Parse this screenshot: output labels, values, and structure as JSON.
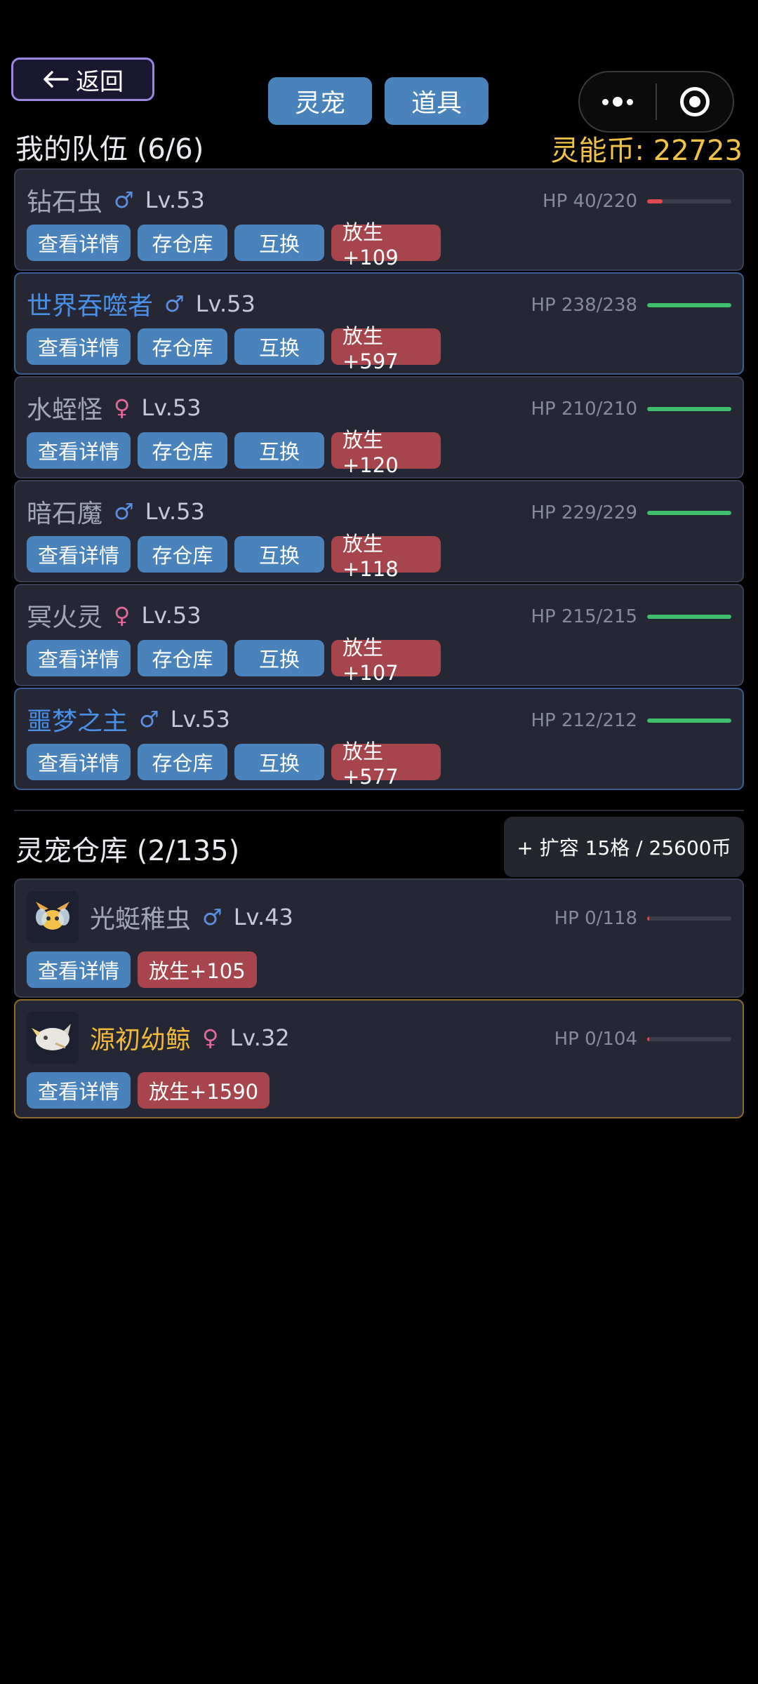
{
  "header": {
    "back_label": "返回",
    "tabs": [
      {
        "label": "灵宠"
      },
      {
        "label": "道具"
      }
    ]
  },
  "team": {
    "title": "我的队伍 (6/6)",
    "coins": "灵能币: 22723",
    "members": [
      {
        "name": "钻石虫",
        "gender": "♂",
        "level": "Lv.53",
        "hp": "HP 40/220",
        "hp_ratio": 0.18,
        "bar_color": "#e04852",
        "name_style": "grey",
        "buttons": [
          "查看详情",
          "存仓库",
          "互换",
          "放生+109"
        ]
      },
      {
        "name": "世界吞噬者",
        "gender": "♂",
        "level": "Lv.53",
        "hp": "HP 238/238",
        "hp_ratio": 1,
        "bar_color": "#3fbf6e",
        "name_style": "blue",
        "buttons": [
          "查看详情",
          "存仓库",
          "互换",
          "放生+597"
        ]
      },
      {
        "name": "水蛭怪",
        "gender": "♀",
        "level": "Lv.53",
        "hp": "HP 210/210",
        "hp_ratio": 1,
        "bar_color": "#3fbf6e",
        "name_style": "grey",
        "buttons": [
          "查看详情",
          "存仓库",
          "互换",
          "放生+120"
        ]
      },
      {
        "name": "暗石魔",
        "gender": "♂",
        "level": "Lv.53",
        "hp": "HP 229/229",
        "hp_ratio": 1,
        "bar_color": "#3fbf6e",
        "name_style": "grey",
        "buttons": [
          "查看详情",
          "存仓库",
          "互换",
          "放生+118"
        ]
      },
      {
        "name": "冥火灵",
        "gender": "♀",
        "level": "Lv.53",
        "hp": "HP 215/215",
        "hp_ratio": 1,
        "bar_color": "#3fbf6e",
        "name_style": "grey",
        "buttons": [
          "查看详情",
          "存仓库",
          "互换",
          "放生+107"
        ]
      },
      {
        "name": "噩梦之主",
        "gender": "♂",
        "level": "Lv.53",
        "hp": "HP 212/212",
        "hp_ratio": 1,
        "bar_color": "#3fbf6e",
        "name_style": "blue",
        "buttons": [
          "查看详情",
          "存仓库",
          "互换",
          "放生+577"
        ]
      }
    ]
  },
  "storage": {
    "title": "灵宠仓库 (2/135)",
    "expand_label": "+ 扩容 15格 / 25600币",
    "items": [
      {
        "name": "光蜓稚虫",
        "gender": "♂",
        "level": "Lv.43",
        "hp": "HP 0/118",
        "hp_ratio": 0,
        "name_style": "grey",
        "buttons": [
          "查看详情",
          "放生+105"
        ]
      },
      {
        "name": "源初幼鲸",
        "gender": "♀",
        "level": "Lv.32",
        "hp": "HP 0/104",
        "hp_ratio": 0,
        "name_style": "gold",
        "buttons": [
          "查看详情",
          "放生+1590"
        ]
      }
    ]
  }
}
